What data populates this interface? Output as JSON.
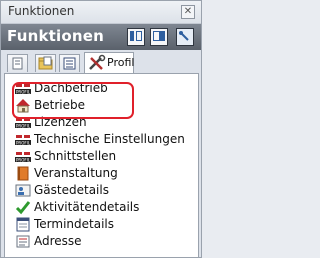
{
  "window": {
    "title": "Funktionen",
    "close_glyph": "✕"
  },
  "header": {
    "title": "Funktionen"
  },
  "tabs": [
    {
      "icon": "document-icon"
    },
    {
      "icon": "folder-icon"
    },
    {
      "icon": "list-icon"
    },
    {
      "label": "Profil",
      "icon": "tools-icon"
    }
  ],
  "list": {
    "items": [
      {
        "label": "Dachbetrieb",
        "icon": "profil-badge-icon"
      },
      {
        "label": "Betriebe",
        "icon": "house-icon"
      },
      {
        "label": "Lizenzen",
        "icon": "profil-badge-icon"
      },
      {
        "label": "Technische Einstellungen",
        "icon": "profil-badge-icon"
      },
      {
        "label": "Schnittstellen",
        "icon": "profil-badge-icon"
      },
      {
        "label": "Veranstaltung",
        "icon": "book-icon"
      },
      {
        "label": "Gästedetails",
        "icon": "user-card-icon"
      },
      {
        "label": "Aktivitätendetails",
        "icon": "checkmark-icon"
      },
      {
        "label": "Termindetails",
        "icon": "calendar-icon"
      },
      {
        "label": "Adresse",
        "icon": "address-icon"
      }
    ]
  },
  "colors": {
    "highlight": "#e0202a",
    "header_bg": "#5a616b"
  }
}
